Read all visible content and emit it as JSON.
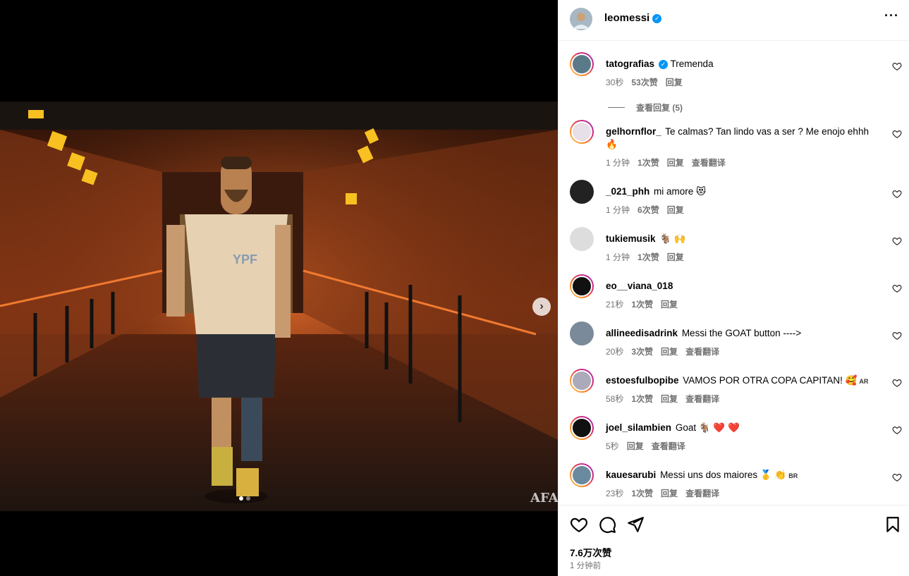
{
  "post": {
    "author": "leomessi",
    "photo_text": {
      "sponsor": "YPF",
      "watermark": "AFA"
    }
  },
  "comments": [
    {
      "user": "tatografias",
      "verified": true,
      "text": "Tremenda",
      "time": "30秒",
      "likes": "53次赞",
      "reply": "回复",
      "translate": ""
    },
    {
      "user": "gelhornflor_",
      "verified": false,
      "text": "Te calmas? Tan lindo vas a ser ? Me enojo ehhh",
      "emoji": "🔥",
      "time": "1 分钟",
      "likes": "1次赞",
      "reply": "回复",
      "translate": "查看翻译"
    },
    {
      "user": "_021_phh",
      "verified": false,
      "text": "mi amore 😻",
      "time": "1 分钟",
      "likes": "6次赞",
      "reply": "回复",
      "translate": ""
    },
    {
      "user": "tukiemusik",
      "verified": false,
      "text": "🐐 🙌",
      "time": "1 分钟",
      "likes": "1次赞",
      "reply": "回复",
      "translate": ""
    },
    {
      "user": "eo__viana_018",
      "verified": false,
      "text": "",
      "time": "21秒",
      "likes": "1次赞",
      "reply": "回复",
      "translate": ""
    },
    {
      "user": "allineedisadrink",
      "verified": false,
      "text": "Messi the GOAT button ---->",
      "time": "20秒",
      "likes": "3次赞",
      "reply": "回复",
      "translate": "查看翻译"
    },
    {
      "user": "estoesfulbopibe",
      "verified": false,
      "text": "VAMOS POR OTRA COPA CAPITAN! 🥰",
      "flag": "AR",
      "time": "58秒",
      "likes": "1次赞",
      "reply": "回复",
      "translate": "查看翻译"
    },
    {
      "user": "joel_silambien",
      "verified": false,
      "text": "Goat 🐐 ❤️ ❤️",
      "time": "5秒",
      "likes": "",
      "reply": "回复",
      "translate": "查看翻译"
    },
    {
      "user": "kauesarubi",
      "verified": false,
      "text": "Messi uns dos maiores 🥇 👏",
      "flag": "BR",
      "time": "23秒",
      "likes": "1次赞",
      "reply": "回复",
      "translate": "查看翻译"
    }
  ],
  "view_replies": "查看回复 (5)",
  "footer": {
    "likes": "7.6万次赞",
    "time": "1 分钟前"
  },
  "colors": {
    "accent": "#0095f6",
    "muted": "#737373",
    "border": "#efefef"
  },
  "icons": [
    "heart-icon",
    "comment-icon",
    "share-icon",
    "bookmark-icon",
    "more-icon",
    "chevron-right-icon"
  ]
}
